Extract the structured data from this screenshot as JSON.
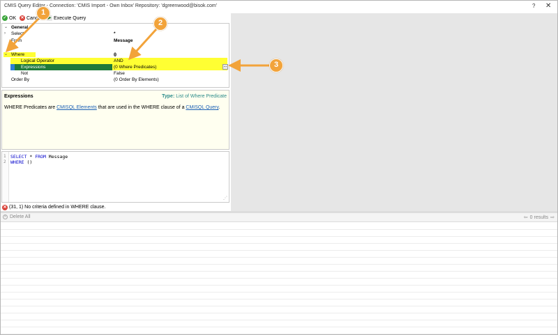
{
  "window": {
    "title": "CMIS Query Editor - Connection: 'CMIS Import - Own Inbox' Repository: 'dgreenwood@bisok.com'",
    "help": "?",
    "close": "✕"
  },
  "toolbar": {
    "ok_label": "OK",
    "cancel_label": "Cance",
    "execute_label": "Execute Query"
  },
  "property_grid": {
    "general": {
      "label": "General"
    },
    "select": {
      "label": "Select",
      "value": "*"
    },
    "from": {
      "label": "From",
      "value": "Message"
    },
    "where": {
      "label": "Where",
      "value": "0"
    },
    "logical_operator": {
      "label": "Logical Operator",
      "value": "AND"
    },
    "expressions": {
      "label": "Expressions",
      "value": "(0 Where Predicates)",
      "button": "..."
    },
    "not": {
      "label": "Not",
      "value": "False"
    },
    "order_by": {
      "label": "Order By",
      "value": "(0 Order By Elements)"
    }
  },
  "description": {
    "title": "Expressions",
    "type_label": "Type:",
    "type_value": "List of Where Predicate",
    "text_before": "WHERE Predicates are ",
    "link1": "CMISQL Elements",
    "text_middle": " that are used in the WHERE clause of a ",
    "link2": "CMISQL Query",
    "text_after": "."
  },
  "editor": {
    "line1_number": "1",
    "line1_kw1": "SELECT",
    "line1_rest1": " * ",
    "line1_kw2": "FROM",
    "line1_rest2": " Message",
    "line2_number": "2",
    "line2_kw": "WHERE",
    "line2_rest": " ()"
  },
  "status": {
    "error_text": "(31, 1) No criteria defined in WHERE clause."
  },
  "results": {
    "delete_all": "Delete All",
    "count": "0 results"
  },
  "callouts": {
    "c1": "1",
    "c2": "2",
    "c3": "3"
  },
  "colors": {
    "highlight": "#ffff33",
    "selected": "#1f7a3a",
    "callout": "#f2a33a",
    "link": "#1a5fb4"
  }
}
